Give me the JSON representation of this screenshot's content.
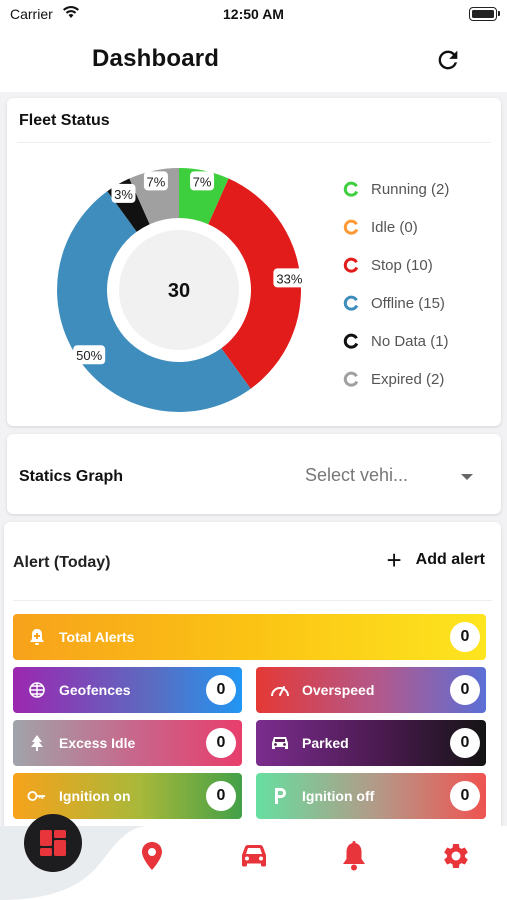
{
  "status_bar": {
    "carrier": "Carrier",
    "time": "12:50 AM"
  },
  "header": {
    "title": "Dashboard",
    "refresh_icon": "refresh-icon"
  },
  "fleet_status": {
    "title": "Fleet Status",
    "total": "30",
    "segments": [
      {
        "label": "Running",
        "count": 2,
        "percent_label": "7%",
        "color": "#3ecf3e"
      },
      {
        "label": "Idle",
        "count": 0,
        "percent_label": "",
        "color": "#ff9933"
      },
      {
        "label": "Stop",
        "count": 10,
        "percent_label": "33%",
        "color": "#e21b1b"
      },
      {
        "label": "Offline",
        "count": 15,
        "percent_label": "50%",
        "color": "#3e8dbd"
      },
      {
        "label": "No Data",
        "count": 1,
        "percent_label": "3%",
        "color": "#111111"
      },
      {
        "label": "Expired",
        "count": 2,
        "percent_label": "7%",
        "color": "#a0a0a0"
      }
    ],
    "legend": [
      {
        "text": "Running (2)",
        "color": "#3ecf3e"
      },
      {
        "text": "Idle (0)",
        "color": "#ff9933"
      },
      {
        "text": "Stop (10)",
        "color": "#e21b1b"
      },
      {
        "text": "Offline (15)",
        "color": "#3e8dbd"
      },
      {
        "text": "No Data (1)",
        "color": "#111111"
      },
      {
        "text": "Expired (2)",
        "color": "#a0a0a0"
      }
    ]
  },
  "statics_graph": {
    "title": "Statics Graph",
    "select_placeholder": "Select vehi..."
  },
  "alerts": {
    "title": "Alert (Today)",
    "add_label": "Add alert",
    "tiles": [
      {
        "label": "Total Alerts",
        "count": "0",
        "icon": "alert-plus-icon"
      },
      {
        "label": "Geofences",
        "count": "0",
        "icon": "geofence-icon"
      },
      {
        "label": "Overspeed",
        "count": "0",
        "icon": "speedometer-icon"
      },
      {
        "label": "Excess Idle",
        "count": "0",
        "icon": "tree-icon"
      },
      {
        "label": "Parked",
        "count": "0",
        "icon": "car-icon"
      },
      {
        "label": "Ignition on",
        "count": "0",
        "icon": "key-icon"
      },
      {
        "label": "Ignition off",
        "count": "0",
        "icon": "parking-icon"
      }
    ]
  },
  "tab_bar": {
    "active": "dashboard",
    "items": [
      "dashboard-icon",
      "map-pin-icon",
      "car-icon",
      "bell-icon",
      "settings-icon"
    ],
    "accent": "#e8343b"
  }
}
